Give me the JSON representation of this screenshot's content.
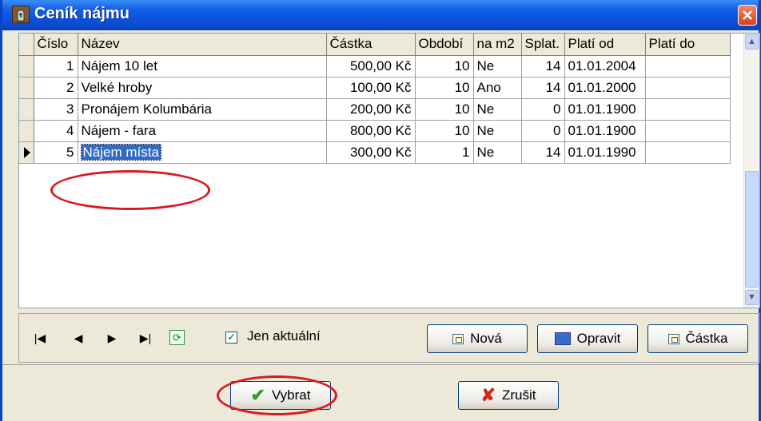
{
  "window": {
    "title": "Ceník nájmu",
    "accent": "#0b4fd9"
  },
  "grid": {
    "columns": [
      "Číslo",
      "Název",
      "Částka",
      "Období",
      "na m2",
      "Splat.",
      "Platí od",
      "Platí do"
    ],
    "rows": [
      {
        "cislo": "1",
        "nazev": "Nájem 10 let",
        "castka": "500,00 Kč",
        "obdobi": "10",
        "na_m2": "Ne",
        "splat": "14",
        "plati_od": "01.01.2004",
        "plati_do": ""
      },
      {
        "cislo": "2",
        "nazev": "Velké hroby",
        "castka": "100,00 Kč",
        "obdobi": "10",
        "na_m2": "Ano",
        "splat": "14",
        "plati_od": "01.01.2000",
        "plati_do": ""
      },
      {
        "cislo": "3",
        "nazev": "Pronájem Kolumbária",
        "castka": "200,00 Kč",
        "obdobi": "10",
        "na_m2": "Ne",
        "splat": "0",
        "plati_od": "01.01.1900",
        "plati_do": ""
      },
      {
        "cislo": "4",
        "nazev": "Nájem - fara",
        "castka": "800,00 Kč",
        "obdobi": "10",
        "na_m2": "Ne",
        "splat": "0",
        "plati_od": "01.01.1900",
        "plati_do": ""
      },
      {
        "cislo": "5",
        "nazev": "Nájem místa",
        "castka": "300,00 Kč",
        "obdobi": "1",
        "na_m2": "Ne",
        "splat": "14",
        "plati_od": "01.01.1990",
        "plati_do": ""
      }
    ],
    "selected_row": 5
  },
  "toolbar": {
    "nav_icons": [
      "first-record-icon",
      "prev-record-icon",
      "next-record-icon",
      "last-record-icon",
      "refresh-icon"
    ],
    "filter_checkbox": {
      "label": "Jen aktuální",
      "checked": true
    },
    "buttons": {
      "new": "Nová",
      "edit": "Opravit",
      "amount": "Částka"
    }
  },
  "footer": {
    "select": "Vybrat",
    "cancel": "Zrušit"
  },
  "highlight_color": "#d8191e"
}
